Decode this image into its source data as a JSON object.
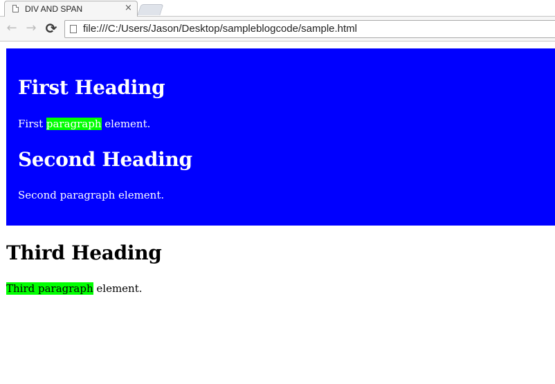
{
  "browser": {
    "tab": {
      "title": "DIV AND SPAN",
      "close": "×"
    },
    "toolbar": {
      "back": "←",
      "forward": "→",
      "reload": "⟳"
    },
    "address": {
      "url": "file:///C:/Users/Jason/Desktop/sampleblogcode/sample.html"
    }
  },
  "page": {
    "div": {
      "background": "#0000ff",
      "first_heading": "First Heading",
      "first_paragraph": {
        "before": "First ",
        "highlight": "paragraph",
        "after": " element."
      },
      "second_heading": "Second Heading",
      "second_paragraph": "Second paragraph element."
    },
    "third_heading": "Third Heading",
    "third_paragraph": {
      "highlight": "Third paragraph",
      "after": " element."
    },
    "highlight_color": "#00ff00"
  }
}
